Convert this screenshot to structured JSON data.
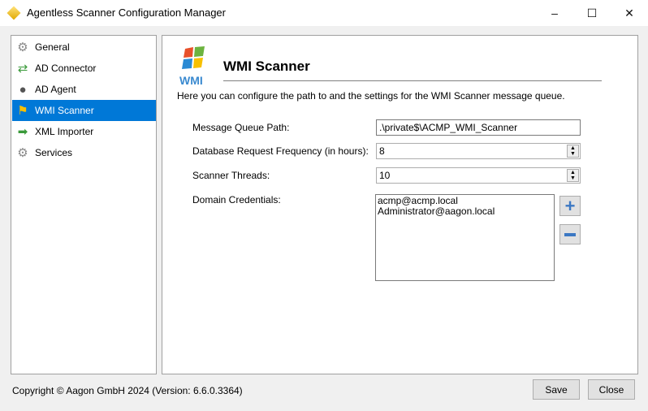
{
  "window": {
    "title": "Agentless Scanner Configuration Manager"
  },
  "nav": {
    "items": [
      {
        "label": "General",
        "icon": "gears-icon"
      },
      {
        "label": "AD Connector",
        "icon": "ad-connector-icon"
      },
      {
        "label": "AD Agent",
        "icon": "ad-agent-icon"
      },
      {
        "label": "WMI Scanner",
        "icon": "wmi-icon",
        "selected": true
      },
      {
        "label": "XML Importer",
        "icon": "xml-importer-icon"
      },
      {
        "label": "Services",
        "icon": "services-gears-icon"
      }
    ]
  },
  "main": {
    "logo_text": "WMI",
    "title": "WMI Scanner",
    "description": "Here you can configure the path to and the settings for the WMI Scanner message queue.",
    "fields": {
      "queue_label": "Message Queue Path:",
      "queue_value": ".\\private$\\ACMP_WMI_Scanner",
      "freq_label": "Database Request Frequency (in hours):",
      "freq_value": "8",
      "threads_label": "Scanner Threads:",
      "threads_value": "10",
      "creds_label": "Domain Credentials:",
      "credentials": [
        "acmp@acmp.local",
        "Administrator@aagon.local"
      ]
    }
  },
  "footer": {
    "copyright": "Copyright © Aagon GmbH 2024 (Version: 6.6.0.3364)",
    "save": "Save",
    "close": "Close"
  }
}
